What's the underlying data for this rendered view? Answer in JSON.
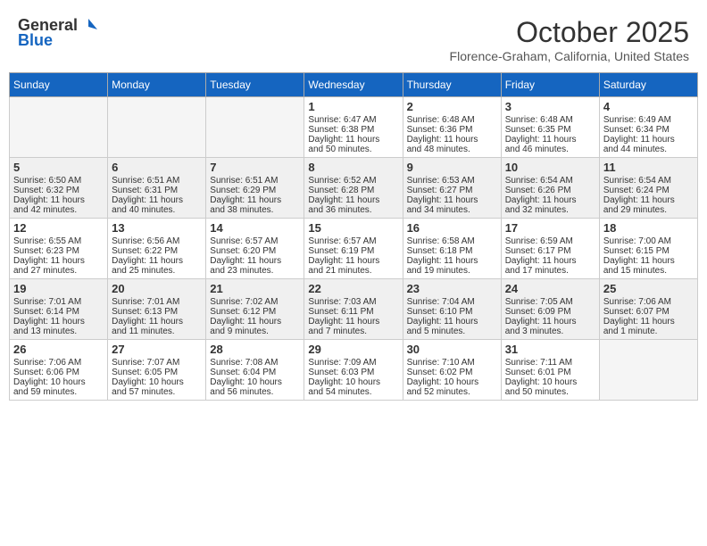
{
  "header": {
    "logo_general": "General",
    "logo_blue": "Blue",
    "month": "October 2025",
    "location": "Florence-Graham, California, United States"
  },
  "weekdays": [
    "Sunday",
    "Monday",
    "Tuesday",
    "Wednesday",
    "Thursday",
    "Friday",
    "Saturday"
  ],
  "weeks": [
    [
      {
        "day": "",
        "empty": true
      },
      {
        "day": "",
        "empty": true
      },
      {
        "day": "",
        "empty": true
      },
      {
        "day": "1",
        "lines": [
          "Sunrise: 6:47 AM",
          "Sunset: 6:38 PM",
          "Daylight: 11 hours",
          "and 50 minutes."
        ]
      },
      {
        "day": "2",
        "lines": [
          "Sunrise: 6:48 AM",
          "Sunset: 6:36 PM",
          "Daylight: 11 hours",
          "and 48 minutes."
        ]
      },
      {
        "day": "3",
        "lines": [
          "Sunrise: 6:48 AM",
          "Sunset: 6:35 PM",
          "Daylight: 11 hours",
          "and 46 minutes."
        ]
      },
      {
        "day": "4",
        "lines": [
          "Sunrise: 6:49 AM",
          "Sunset: 6:34 PM",
          "Daylight: 11 hours",
          "and 44 minutes."
        ]
      }
    ],
    [
      {
        "day": "5",
        "lines": [
          "Sunrise: 6:50 AM",
          "Sunset: 6:32 PM",
          "Daylight: 11 hours",
          "and 42 minutes."
        ]
      },
      {
        "day": "6",
        "lines": [
          "Sunrise: 6:51 AM",
          "Sunset: 6:31 PM",
          "Daylight: 11 hours",
          "and 40 minutes."
        ]
      },
      {
        "day": "7",
        "lines": [
          "Sunrise: 6:51 AM",
          "Sunset: 6:29 PM",
          "Daylight: 11 hours",
          "and 38 minutes."
        ]
      },
      {
        "day": "8",
        "lines": [
          "Sunrise: 6:52 AM",
          "Sunset: 6:28 PM",
          "Daylight: 11 hours",
          "and 36 minutes."
        ]
      },
      {
        "day": "9",
        "lines": [
          "Sunrise: 6:53 AM",
          "Sunset: 6:27 PM",
          "Daylight: 11 hours",
          "and 34 minutes."
        ]
      },
      {
        "day": "10",
        "lines": [
          "Sunrise: 6:54 AM",
          "Sunset: 6:26 PM",
          "Daylight: 11 hours",
          "and 32 minutes."
        ]
      },
      {
        "day": "11",
        "lines": [
          "Sunrise: 6:54 AM",
          "Sunset: 6:24 PM",
          "Daylight: 11 hours",
          "and 29 minutes."
        ]
      }
    ],
    [
      {
        "day": "12",
        "lines": [
          "Sunrise: 6:55 AM",
          "Sunset: 6:23 PM",
          "Daylight: 11 hours",
          "and 27 minutes."
        ]
      },
      {
        "day": "13",
        "lines": [
          "Sunrise: 6:56 AM",
          "Sunset: 6:22 PM",
          "Daylight: 11 hours",
          "and 25 minutes."
        ]
      },
      {
        "day": "14",
        "lines": [
          "Sunrise: 6:57 AM",
          "Sunset: 6:20 PM",
          "Daylight: 11 hours",
          "and 23 minutes."
        ]
      },
      {
        "day": "15",
        "lines": [
          "Sunrise: 6:57 AM",
          "Sunset: 6:19 PM",
          "Daylight: 11 hours",
          "and 21 minutes."
        ]
      },
      {
        "day": "16",
        "lines": [
          "Sunrise: 6:58 AM",
          "Sunset: 6:18 PM",
          "Daylight: 11 hours",
          "and 19 minutes."
        ]
      },
      {
        "day": "17",
        "lines": [
          "Sunrise: 6:59 AM",
          "Sunset: 6:17 PM",
          "Daylight: 11 hours",
          "and 17 minutes."
        ]
      },
      {
        "day": "18",
        "lines": [
          "Sunrise: 7:00 AM",
          "Sunset: 6:15 PM",
          "Daylight: 11 hours",
          "and 15 minutes."
        ]
      }
    ],
    [
      {
        "day": "19",
        "lines": [
          "Sunrise: 7:01 AM",
          "Sunset: 6:14 PM",
          "Daylight: 11 hours",
          "and 13 minutes."
        ]
      },
      {
        "day": "20",
        "lines": [
          "Sunrise: 7:01 AM",
          "Sunset: 6:13 PM",
          "Daylight: 11 hours",
          "and 11 minutes."
        ]
      },
      {
        "day": "21",
        "lines": [
          "Sunrise: 7:02 AM",
          "Sunset: 6:12 PM",
          "Daylight: 11 hours",
          "and 9 minutes."
        ]
      },
      {
        "day": "22",
        "lines": [
          "Sunrise: 7:03 AM",
          "Sunset: 6:11 PM",
          "Daylight: 11 hours",
          "and 7 minutes."
        ]
      },
      {
        "day": "23",
        "lines": [
          "Sunrise: 7:04 AM",
          "Sunset: 6:10 PM",
          "Daylight: 11 hours",
          "and 5 minutes."
        ]
      },
      {
        "day": "24",
        "lines": [
          "Sunrise: 7:05 AM",
          "Sunset: 6:09 PM",
          "Daylight: 11 hours",
          "and 3 minutes."
        ]
      },
      {
        "day": "25",
        "lines": [
          "Sunrise: 7:06 AM",
          "Sunset: 6:07 PM",
          "Daylight: 11 hours",
          "and 1 minute."
        ]
      }
    ],
    [
      {
        "day": "26",
        "lines": [
          "Sunrise: 7:06 AM",
          "Sunset: 6:06 PM",
          "Daylight: 10 hours",
          "and 59 minutes."
        ]
      },
      {
        "day": "27",
        "lines": [
          "Sunrise: 7:07 AM",
          "Sunset: 6:05 PM",
          "Daylight: 10 hours",
          "and 57 minutes."
        ]
      },
      {
        "day": "28",
        "lines": [
          "Sunrise: 7:08 AM",
          "Sunset: 6:04 PM",
          "Daylight: 10 hours",
          "and 56 minutes."
        ]
      },
      {
        "day": "29",
        "lines": [
          "Sunrise: 7:09 AM",
          "Sunset: 6:03 PM",
          "Daylight: 10 hours",
          "and 54 minutes."
        ]
      },
      {
        "day": "30",
        "lines": [
          "Sunrise: 7:10 AM",
          "Sunset: 6:02 PM",
          "Daylight: 10 hours",
          "and 52 minutes."
        ]
      },
      {
        "day": "31",
        "lines": [
          "Sunrise: 7:11 AM",
          "Sunset: 6:01 PM",
          "Daylight: 10 hours",
          "and 50 minutes."
        ]
      },
      {
        "day": "",
        "empty": true
      }
    ]
  ]
}
